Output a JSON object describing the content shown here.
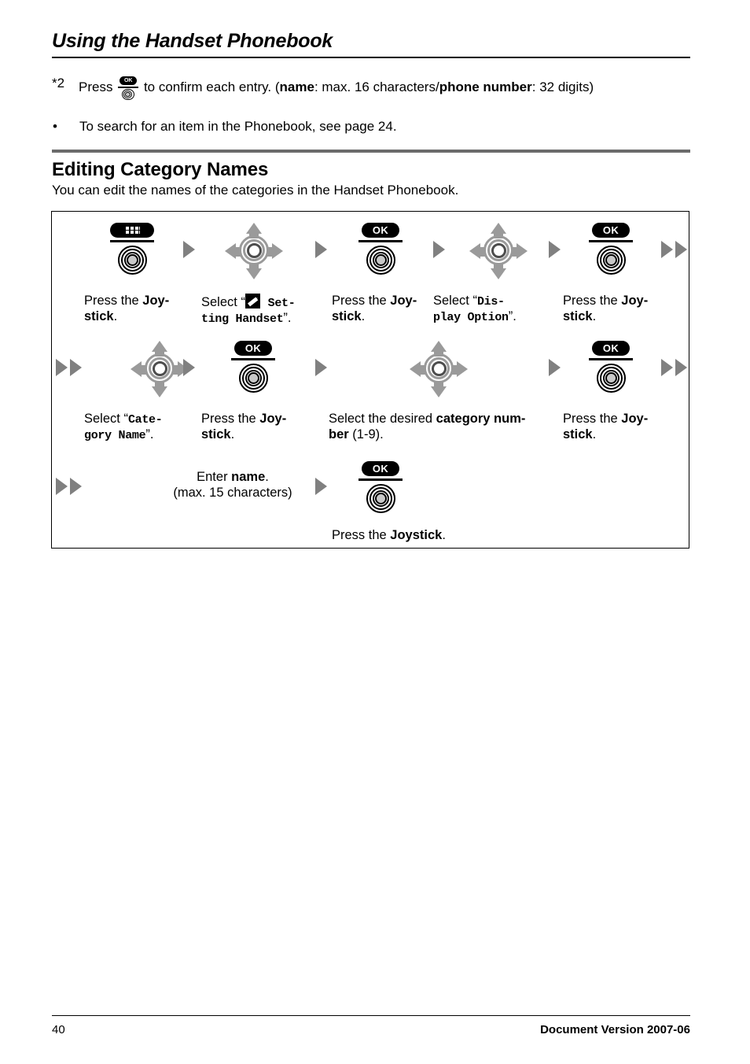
{
  "header": {
    "title": "Using the Handset Phonebook"
  },
  "notes": [
    {
      "marker": "*2",
      "text_before": "Press",
      "icon": "ok-joystick-icon",
      "icon_label": "OK",
      "text_after_1": "to confirm each entry. (",
      "bold_1": "name",
      "text_after_2": ": max. 16 characters/",
      "bold_2": "phone number",
      "text_after_3": ": 32 digits)"
    },
    {
      "marker": "•",
      "text": "To search for an item in the Phonebook, see page 24."
    }
  ],
  "section": {
    "title": "Editing Category Names",
    "description": "You can edit the names of the categories in the Handset Phonebook."
  },
  "flow": {
    "rows": [
      {
        "steps": [
          {
            "icon": "menu-joystick-icon",
            "pill_label": "menu-grid-icon",
            "caption_plain_1": "Press the ",
            "caption_bold_1": "Joy-",
            "caption_bold_2": "stick",
            "caption_plain_2": "."
          },
          {
            "icon": "navigation-joystick-icon",
            "caption_plain_1": "Select “",
            "caption_icon": "pencil-edit-icon",
            "caption_mono": "Set-ting Handset",
            "caption_mono_line1": " Set-",
            "caption_mono_line2": "ting Handset",
            "caption_plain_2": "”."
          },
          {
            "icon": "ok-joystick-icon",
            "pill_label": "OK",
            "caption_plain_1": "Press the ",
            "caption_bold_1": "Joy-",
            "caption_bold_2": "stick",
            "caption_plain_2": "."
          },
          {
            "icon": "navigation-joystick-icon",
            "caption_plain_1": "Select “",
            "caption_mono_line1": "Dis-",
            "caption_mono_line2": "play Option",
            "caption_plain_2": "”."
          },
          {
            "icon": "ok-joystick-icon",
            "pill_label": "OK",
            "caption_plain_1": "Press the ",
            "caption_bold_1": "Joy-",
            "caption_bold_2": "stick",
            "caption_plain_2": "."
          }
        ]
      },
      {
        "steps": [
          {
            "icon": "navigation-joystick-icon",
            "caption_plain_1": "Select “",
            "caption_mono_line1": "Cate-",
            "caption_mono_line2": "gory Name",
            "caption_plain_2": "”."
          },
          {
            "icon": "ok-joystick-icon",
            "pill_label": "OK",
            "caption_plain_1": "Press the ",
            "caption_bold_1": "Joy-",
            "caption_bold_2": "stick",
            "caption_plain_2": "."
          },
          {
            "icon": "navigation-joystick-icon",
            "caption_plain_1": "Select the desired ",
            "caption_bold_1": "category num-",
            "caption_bold_2": "ber",
            "caption_plain_2": " (1-9)."
          },
          {
            "icon": "ok-joystick-icon",
            "pill_label": "OK",
            "caption_plain_1": "Press the ",
            "caption_bold_1": "Joy-",
            "caption_bold_2": "stick",
            "caption_plain_2": "."
          }
        ]
      },
      {
        "steps": [
          {
            "caption_plain_1": "Enter ",
            "caption_bold_1": "name",
            "caption_plain_2": ".",
            "caption_line2": "(max. 15 characters)"
          },
          {
            "icon": "ok-joystick-icon",
            "pill_label": "OK",
            "caption_plain_1": "Press the ",
            "caption_bold_1": "Joystick",
            "caption_plain_2": "."
          }
        ]
      }
    ]
  },
  "footer": {
    "page_number": "40",
    "document_version": "Document Version 2007-06"
  },
  "colors": {
    "section_rule": "#6b6b6b",
    "arrow_gray": "#808080",
    "nav_gray": "#9a9a9a",
    "button_black": "#000000"
  }
}
